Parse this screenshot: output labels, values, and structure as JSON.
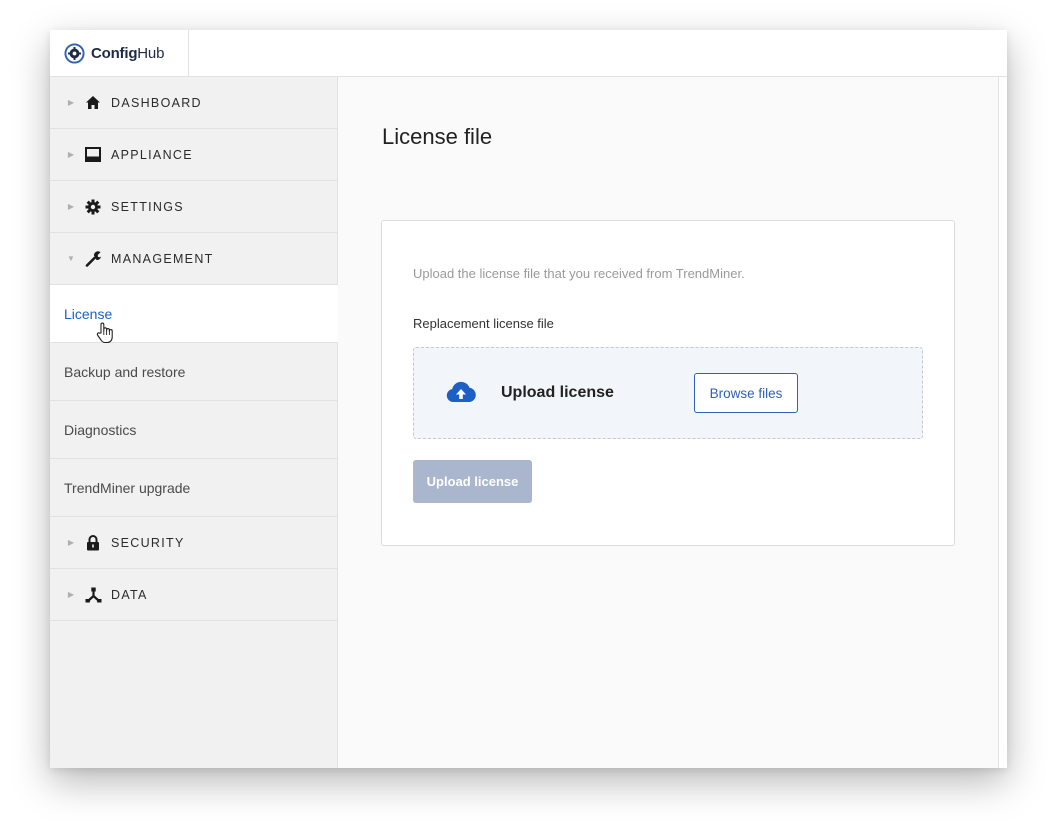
{
  "app": {
    "logo_bold": "Config",
    "logo_light": "Hub"
  },
  "colors": {
    "accent": "#2f62b3",
    "active_link": "#1b5fc7",
    "disabled_button": "#a9b6cd",
    "dropzone_bg": "#f2f5fa"
  },
  "sidebar": {
    "sections_top": [
      {
        "label": "DASHBOARD",
        "icon": "home-icon",
        "expanded": false
      },
      {
        "label": "APPLIANCE",
        "icon": "appliance-icon",
        "expanded": false
      },
      {
        "label": "SETTINGS",
        "icon": "gear-icon",
        "expanded": false
      },
      {
        "label": "MANAGEMENT",
        "icon": "wrench-icon",
        "expanded": true
      }
    ],
    "management_items": [
      {
        "label": "License",
        "active": true
      },
      {
        "label": "Backup and restore",
        "active": false
      },
      {
        "label": "Diagnostics",
        "active": false
      },
      {
        "label": "TrendMiner upgrade",
        "active": false
      }
    ],
    "sections_bottom": [
      {
        "label": "SECURITY",
        "icon": "lock-icon",
        "expanded": false
      },
      {
        "label": "DATA",
        "icon": "data-tree-icon",
        "expanded": false
      }
    ]
  },
  "main": {
    "title": "License file",
    "intro": "Upload the license file that you received from TrendMiner.",
    "field_label": "Replacement license file",
    "dropzone": {
      "title": "Upload license",
      "browse_label": "Browse files",
      "icon": "cloud-upload-icon"
    },
    "submit_label": "Upload license",
    "submit_disabled": true
  }
}
